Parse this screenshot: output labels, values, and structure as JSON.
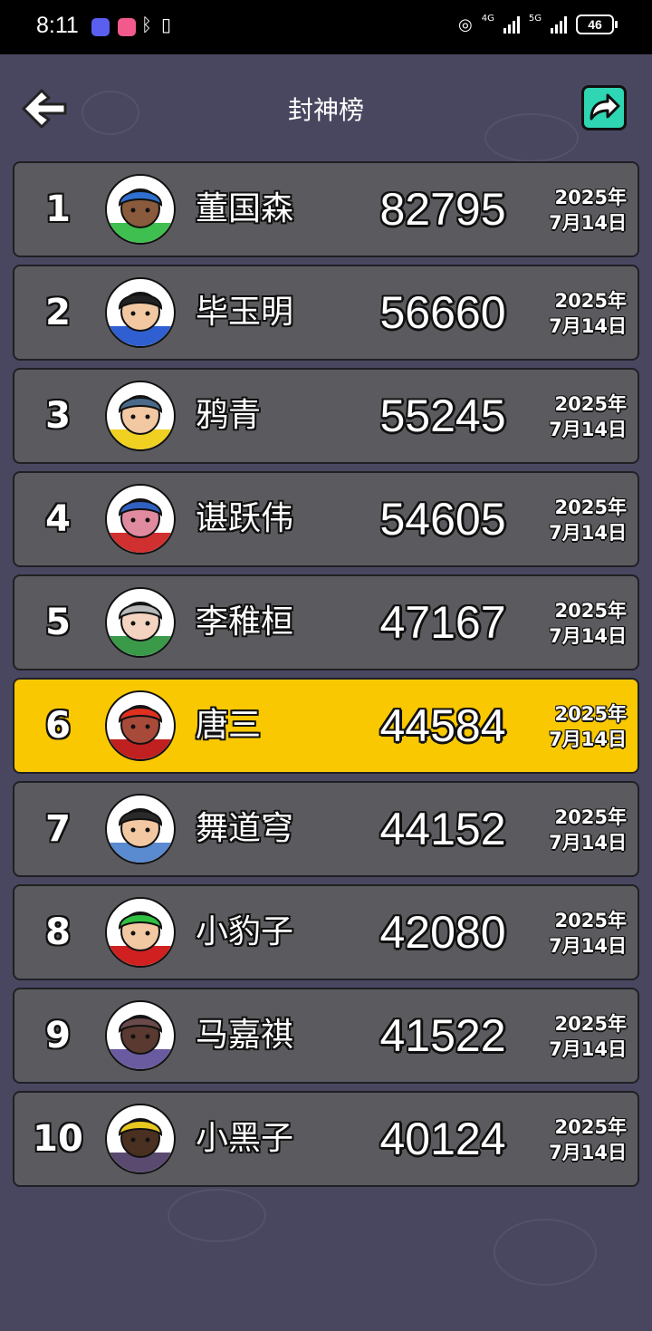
{
  "status_bar": {
    "time": "8:11",
    "network_1": "4G",
    "network_2": "5G",
    "battery": "46"
  },
  "header": {
    "title": "封神榜",
    "back_icon": "back-arrow-icon",
    "share_icon": "share-icon"
  },
  "leaderboard": [
    {
      "rank": "1",
      "name": "董国森",
      "score": "82795",
      "date_year": "2025年",
      "date_day": "7月14日",
      "hair": "#2f6fd0",
      "shirt": "#3fbf4f",
      "skin": "#8a5a3c"
    },
    {
      "rank": "2",
      "name": "毕玉明",
      "score": "56660",
      "date_year": "2025年",
      "date_day": "7月14日",
      "hair": "#222222",
      "shirt": "#2f5fd0",
      "skin": "#f2c8a2"
    },
    {
      "rank": "3",
      "name": "鸦青",
      "score": "55245",
      "date_year": "2025年",
      "date_day": "7月14日",
      "hair": "#4a6a8a",
      "shirt": "#f0d020",
      "skin": "#f2c8a2"
    },
    {
      "rank": "4",
      "name": "谌跃伟",
      "score": "54605",
      "date_year": "2025年",
      "date_day": "7月14日",
      "hair": "#3060c0",
      "shirt": "#d03030",
      "skin": "#e08aa0"
    },
    {
      "rank": "5",
      "name": "李稚桓",
      "score": "47167",
      "date_year": "2025年",
      "date_day": "7月14日",
      "hair": "#b8b8b8",
      "shirt": "#3a9a4a",
      "skin": "#f4d4c0"
    },
    {
      "rank": "6",
      "name": "唐三",
      "score": "44584",
      "date_year": "2025年",
      "date_day": "7月14日",
      "hair": "#e03020",
      "shirt": "#c02020",
      "skin": "#a84a3a",
      "highlight": true
    },
    {
      "rank": "7",
      "name": "舞道穹",
      "score": "44152",
      "date_year": "2025年",
      "date_day": "7月14日",
      "hair": "#2a2a2a",
      "shirt": "#5a8ad0",
      "skin": "#f2c8a2"
    },
    {
      "rank": "8",
      "name": "小豹子",
      "score": "42080",
      "date_year": "2025年",
      "date_day": "7月14日",
      "hair": "#30c040",
      "shirt": "#d02020",
      "skin": "#f2c8a2"
    },
    {
      "rank": "9",
      "name": "马嘉祺",
      "score": "41522",
      "date_year": "2025年",
      "date_day": "7月14日",
      "hair": "#6a4a4a",
      "shirt": "#6a5aa0",
      "skin": "#5a3a30"
    },
    {
      "rank": "10",
      "name": "小黑子",
      "score": "40124",
      "date_year": "2025年",
      "date_day": "7月14日",
      "hair": "#e8c820",
      "shirt": "#5a4a70",
      "skin": "#4a3020"
    }
  ],
  "colors": {
    "background": "#494760",
    "row": "#5b5b5f",
    "highlight_row": "#f9c800",
    "share_button": "#2fd6b4"
  }
}
